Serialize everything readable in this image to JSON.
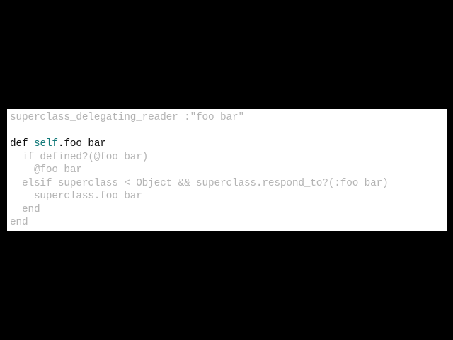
{
  "colors": {
    "background": "#000000",
    "panel": "#ffffff",
    "faded_text": "#b4b4b4",
    "emphasis_text": "#101010",
    "self_keyword": "#137a7a"
  },
  "code": {
    "line1": "superclass_delegating_reader :\"foo bar\"",
    "line2": "",
    "line3": {
      "def": "def",
      "self": "self",
      "rest": ".foo bar"
    },
    "line4": "  if defined?(@foo bar)",
    "line5": "    @foo bar",
    "line6": "  elsif superclass < Object && superclass.respond_to?(:foo bar)",
    "line7": "    superclass.foo bar",
    "line8": "  end",
    "line9": "end"
  }
}
